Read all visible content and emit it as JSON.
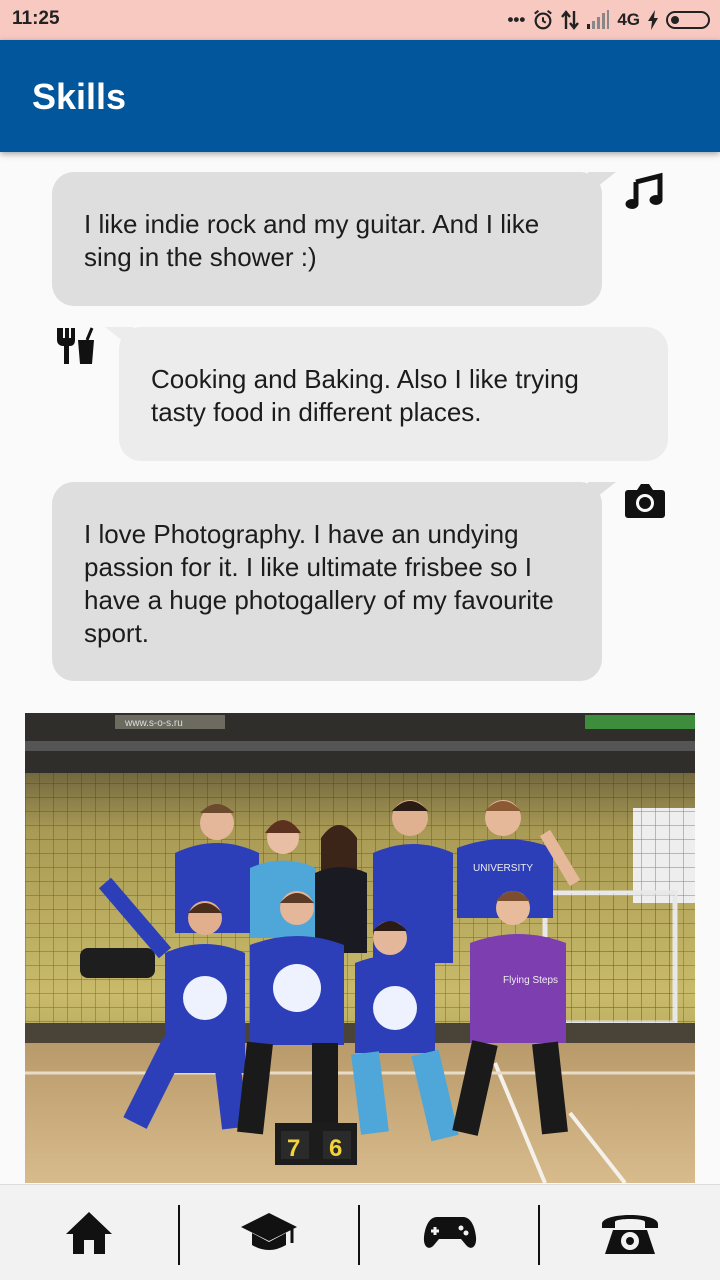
{
  "status_bar": {
    "time": "11:25",
    "network": "4G"
  },
  "app_bar": {
    "title": "Skills"
  },
  "skills": [
    {
      "icon": "music-note-icon",
      "text": "I like indie rock and my guitar. And I like sing in the shower :)"
    },
    {
      "icon": "fork-and-drink-icon",
      "text": "Cooking and Baking. Also I like trying tasty food in different places."
    },
    {
      "icon": "camera-icon",
      "text": "I love Photography. I have an undying passion for it. I like ultimate frisbee so I have a huge photogallery of my favourite sport."
    }
  ],
  "photo": {
    "banner_text": "www.s-o-s.ru",
    "shirt_text_1": "UNIVERSITY",
    "shirt_text_2": "Flying Steps",
    "score": [
      "7",
      "6"
    ]
  },
  "bottom_nav": [
    {
      "icon": "home-icon"
    },
    {
      "icon": "graduation-cap-icon"
    },
    {
      "icon": "gamepad-icon"
    },
    {
      "icon": "phone-icon"
    }
  ],
  "colors": {
    "app_bar": "#02569b",
    "status_bar": "#f8c9c1",
    "bubble": "#dedede",
    "bubble_light": "#ececec"
  }
}
